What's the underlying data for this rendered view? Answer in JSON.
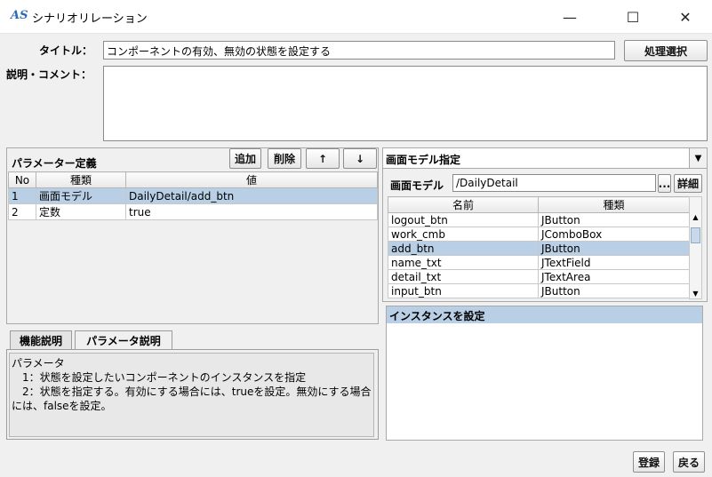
{
  "window": {
    "title": "シナリオリレーション",
    "app_icon": "AS",
    "minimize_glyph": "—",
    "maximize_glyph": "☐",
    "close_glyph": "✕"
  },
  "form": {
    "title_label": "タイトル：",
    "title_value": "コンポーネントの有効、無効の状態を設定する",
    "process_select_label": "処理選択",
    "comment_label": "説明・コメント：",
    "comment_value": ""
  },
  "params": {
    "header": "パラメーター定義",
    "add_label": "追加",
    "delete_label": "削除",
    "up_glyph": "↑",
    "down_glyph": "↓",
    "columns": [
      "No",
      "種類",
      "値"
    ],
    "rows": [
      {
        "no": "1",
        "kind": "画面モデル",
        "value": "DailyDetail/add_btn"
      },
      {
        "no": "2",
        "kind": "定数",
        "value": "true"
      }
    ],
    "selected_row": 0
  },
  "desc_tabs": {
    "tab_function": "機能説明",
    "tab_param": "パラメータ説明",
    "lines": [
      "パラメータ",
      "　1：状態を設定したいコンポーネントのインスタンスを指定",
      "　2：状態を指定する。有効にする場合には、trueを設定。無効にする場合",
      "には、falseを設定。"
    ]
  },
  "model": {
    "combo_value": "画面モデル指定",
    "model_label": "画面モデル",
    "model_value": "/DailyDetail",
    "ellipsis_label": "...",
    "detail_label": "詳細",
    "columns": [
      "名前",
      "種類"
    ],
    "rows": [
      {
        "name": "logout_btn",
        "type": "JButton"
      },
      {
        "name": "work_cmb",
        "type": "JComboBox"
      },
      {
        "name": "add_btn",
        "type": "JButton"
      },
      {
        "name": "name_txt",
        "type": "JTextField"
      },
      {
        "name": "detail_txt",
        "type": "JTextArea"
      },
      {
        "name": "input_btn",
        "type": "JButton"
      }
    ],
    "selected_row": 2,
    "instance_header": "インスタンスを設定"
  },
  "footer": {
    "register_label": "登録",
    "back_label": "戻る"
  }
}
